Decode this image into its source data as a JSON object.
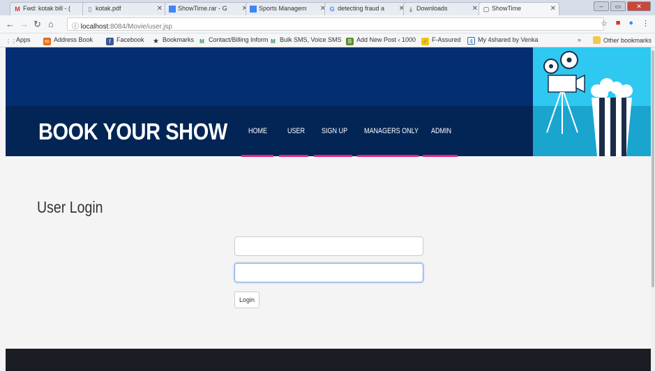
{
  "browser": {
    "tabs": [
      {
        "label": "Fwd: kotak bill - (",
        "icon": "gmail-icon"
      },
      {
        "label": "kotak.pdf",
        "icon": "doc-icon"
      },
      {
        "label": "ShowTime.rar - G",
        "icon": "drive-icon"
      },
      {
        "label": "Sports Managem",
        "icon": "drive-icon"
      },
      {
        "label": "detecting fraud a",
        "icon": "google-icon"
      },
      {
        "label": "Downloads",
        "icon": "download-icon"
      },
      {
        "label": "ShowTime",
        "icon": "page-icon"
      }
    ],
    "url_host": "localhost",
    "url_path": ":8084/Movie/user.jsp",
    "bookmarks": [
      {
        "label": "Apps"
      },
      {
        "label": "Address Book"
      },
      {
        "label": "Facebook"
      },
      {
        "label": "Bookmarks"
      },
      {
        "label": "Contact/Billing Inform"
      },
      {
        "label": "Bulk SMS, Voice SMS"
      },
      {
        "label": "Add New Post ‹ 1000"
      },
      {
        "label": "F-Assured"
      },
      {
        "label": "My 4shared by Venka"
      },
      {
        "label": "Other bookmarks"
      }
    ]
  },
  "site": {
    "logo": "BOOK YOUR SHOW",
    "nav": [
      "HOME",
      "USER",
      "SIGN UP",
      "MANAGERS ONLY",
      "ADMIN"
    ]
  },
  "main": {
    "title": "User Login",
    "username_placeholder": "",
    "password_placeholder": "",
    "login_label": "Login"
  },
  "colors": {
    "header": "#032e72",
    "band": "#032555",
    "accent": "#e6247c",
    "promo": "#2ec8f0"
  }
}
